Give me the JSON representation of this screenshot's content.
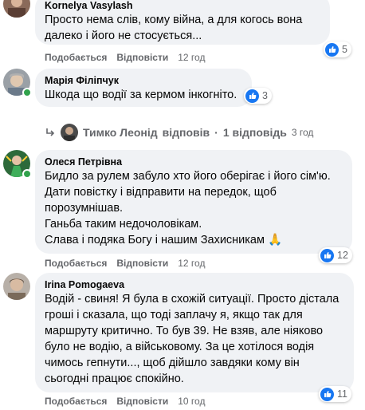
{
  "comments": [
    {
      "author": "Kornelya Vasylash",
      "text": "Просто нема слів, кому війна, а для когось вона\nдалеко і його не стосується...",
      "like_label": "Подобається",
      "reply_label": "Відповісти",
      "time": "12 год",
      "reactions": "5"
    },
    {
      "author": "Марія Філіпчук",
      "text": "Шкода що водії за кермом інкогніто.",
      "reactions": "3",
      "reply_thread": {
        "author": "Тимко Леонід",
        "verb": "відповів",
        "count": "1 відповідь",
        "separator": "·",
        "time": "3 год"
      }
    },
    {
      "author": "Олеся Петрівна",
      "text": "Бидло за рулем забуло хто його оберігає і його сім'ю.\nДати повістку і відправити на передок, щоб\nпорозумнішав.\nГаньба таким недочоловікам.\nСлава і подяка Богу і нашим Захисникам 🙏",
      "like_label": "Подобається",
      "reply_label": "Відповісти",
      "time": "12 год",
      "reactions": "12"
    },
    {
      "author": "Irina Pomogaeva",
      "text": "Водій - свиня! Я була в схожій ситуації. Просто дістала\nгроші і сказала, що тоді заплачу я, якщо так для\nмаршруту критично. То був 39. Не взяв, але ніяково\nбуло не водію, а військовому. За це хотілося водія\nчимось гепнути..., щоб дійшло завдяки кому він\nсьогодні працює спокійно.",
      "like_label": "Подобається",
      "reply_label": "Відповісти",
      "time": "10 год",
      "reactions": "11"
    }
  ],
  "colors": {
    "bubble": "#f0f2f5",
    "meta": "#65676b",
    "like_blue": "#1877f2",
    "online": "#31a24c"
  }
}
